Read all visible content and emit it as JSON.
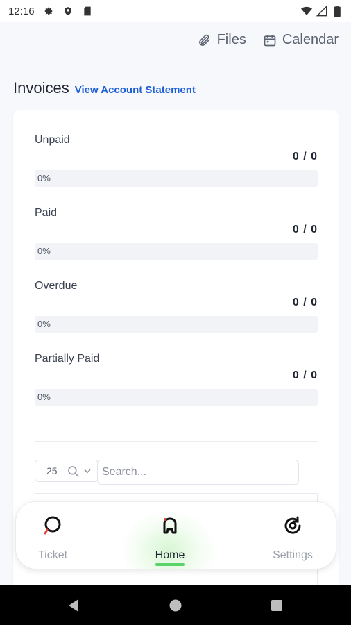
{
  "status_bar": {
    "time": "12:16",
    "icons_left": [
      "settings-icon",
      "shield-icon",
      "sim-card-icon"
    ],
    "icons_right": [
      "wifi-icon",
      "cell-signal-icon",
      "battery-icon"
    ]
  },
  "top_links": {
    "files": "Files",
    "calendar": "Calendar"
  },
  "invoices": {
    "title": "Invoices",
    "statement_link": "View Account Statement",
    "stats": [
      {
        "label": "Unpaid",
        "count": "0 / 0",
        "percent_text": "0%",
        "progress": 0
      },
      {
        "label": "Paid",
        "count": "0 / 0",
        "percent_text": "0%",
        "progress": 0
      },
      {
        "label": "Overdue",
        "count": "0 / 0",
        "percent_text": "0%",
        "progress": 0
      },
      {
        "label": "Partially Paid",
        "count": "0 / 0",
        "percent_text": "0%",
        "progress": 0
      }
    ]
  },
  "table_controls": {
    "page_size": "25",
    "search_placeholder": "Search..."
  },
  "bottom_nav": {
    "items": [
      {
        "label": "Ticket",
        "icon": "ticket-icon",
        "active": false
      },
      {
        "label": "Home",
        "icon": "home-icon",
        "active": true
      },
      {
        "label": "Settings",
        "icon": "settings-icon",
        "active": false
      }
    ]
  },
  "colors": {
    "accent": "#1f5fd6",
    "active_indicator": "#5ad36a",
    "background": "#f6f8fb"
  }
}
